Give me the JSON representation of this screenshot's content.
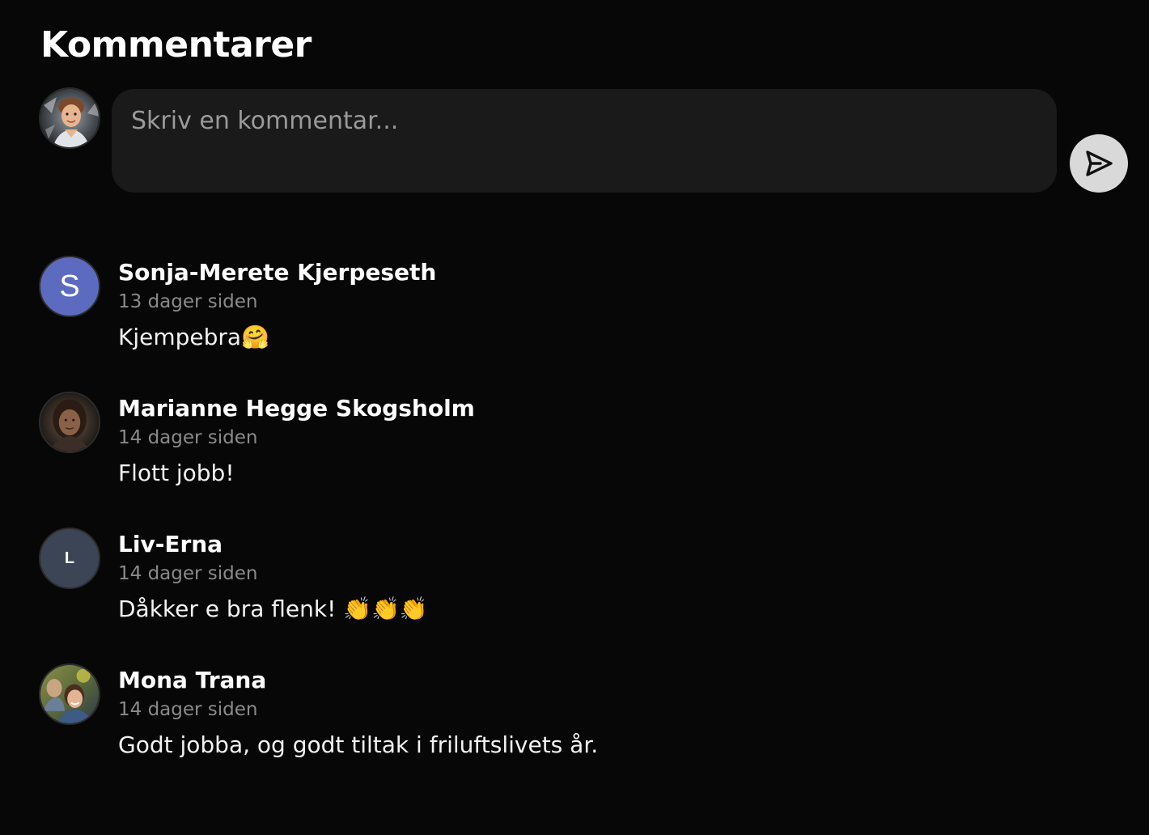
{
  "header": {
    "title": "Kommentarer"
  },
  "composer": {
    "placeholder": "Skriv en kommentar...",
    "avatar_icon": "user-photo-icon",
    "send_icon": "send-icon",
    "send_button_color": "#d9d9d9"
  },
  "comments": [
    {
      "author": "Sonja-Merete Kjerpeseth",
      "time": "13 dager siden",
      "text": "Kjempebra🤗",
      "avatar": {
        "type": "initial",
        "initial": "S",
        "color": "#5c6bc0"
      }
    },
    {
      "author": "Marianne Hegge Skogsholm",
      "time": "14 dager siden",
      "text": "Flott jobb!",
      "avatar": {
        "type": "photo"
      }
    },
    {
      "author": "Liv-Erna",
      "time": "14 dager siden",
      "text": "Dåkker e bra flenk! 👏👏👏",
      "avatar": {
        "type": "initial",
        "initial": "L",
        "color": "#3c4556"
      }
    },
    {
      "author": "Mona Trana",
      "time": "14 dager siden",
      "text": "Godt jobba, og godt tiltak i friluftslivets år.",
      "avatar": {
        "type": "photo"
      }
    }
  ]
}
